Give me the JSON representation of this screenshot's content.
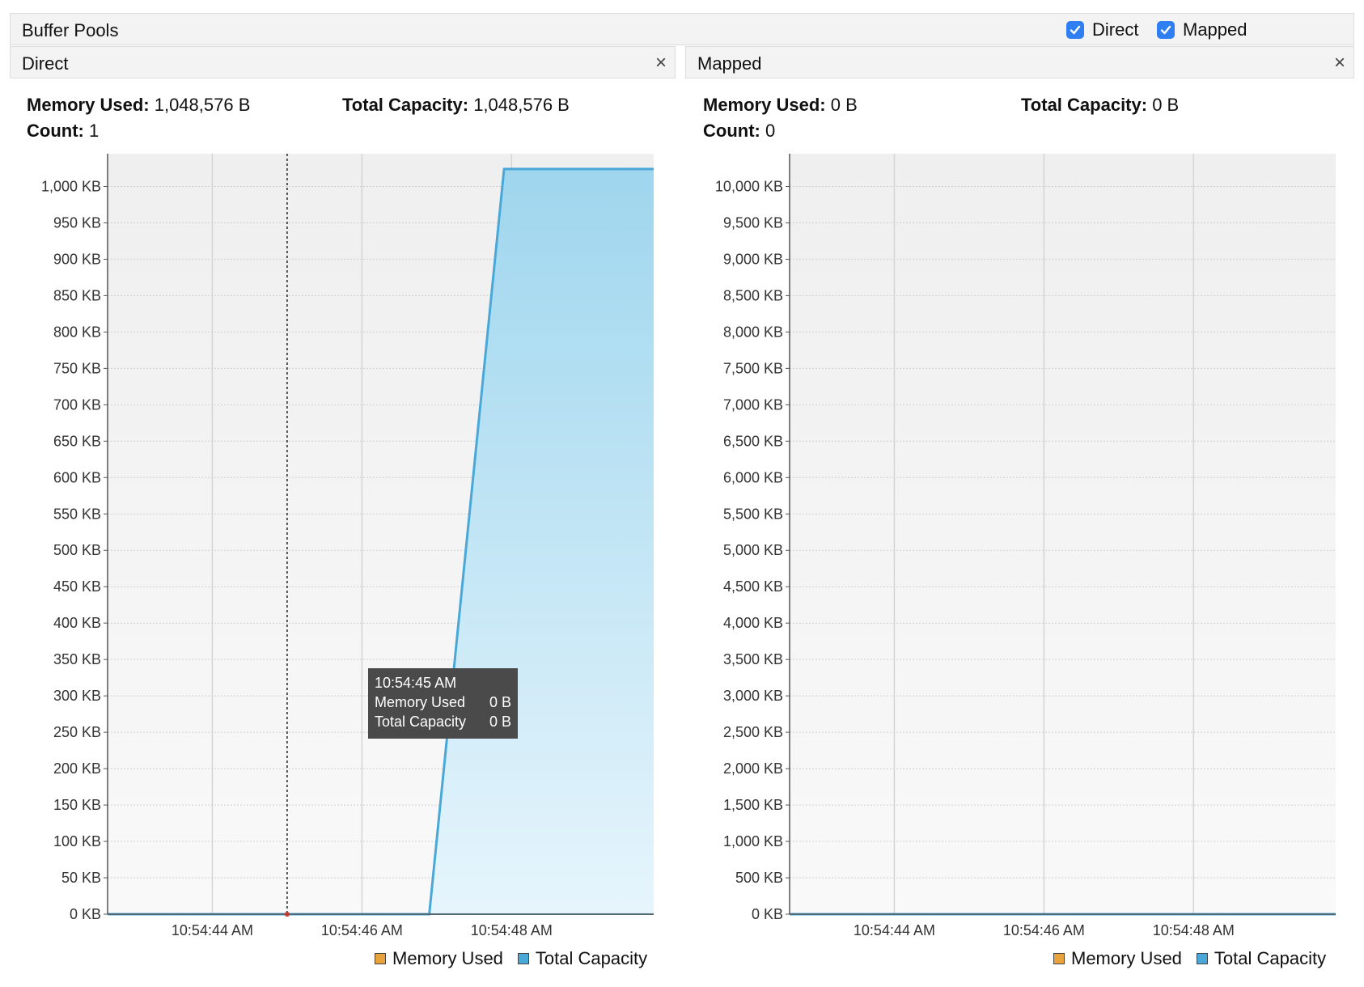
{
  "window": {
    "title": "Buffer Pools",
    "checkboxes": [
      {
        "label": "Direct",
        "checked": true
      },
      {
        "label": "Mapped",
        "checked": true
      }
    ]
  },
  "panels": [
    {
      "name": "Direct",
      "close_icon": "×",
      "stats": {
        "memory_used_label": "Memory Used:",
        "memory_used": "1,048,576 B",
        "total_capacity_label": "Total Capacity:",
        "total_capacity": "1,048,576 B",
        "count_label": "Count:",
        "count": "1"
      },
      "tooltip": {
        "time": "10:54:45 AM",
        "rows": [
          {
            "label": "Memory Used",
            "value": "0 B"
          },
          {
            "label": "Total Capacity",
            "value": "0 B"
          }
        ]
      },
      "legend": [
        "Memory Used",
        "Total Capacity"
      ]
    },
    {
      "name": "Mapped",
      "close_icon": "×",
      "stats": {
        "memory_used_label": "Memory Used:",
        "memory_used": "0 B",
        "total_capacity_label": "Total Capacity:",
        "total_capacity": "0 B",
        "count_label": "Count:",
        "count": "0"
      },
      "legend": [
        "Memory Used",
        "Total Capacity"
      ]
    }
  ],
  "colors": {
    "memory_used": "#e8a33d",
    "total_capacity": "#4aa8d8",
    "checkbox": "#2f7ef2"
  },
  "chart_data": [
    {
      "type": "area",
      "title": "",
      "ylabel": "",
      "xlabel": "",
      "y_unit": "KB",
      "ylim": [
        0,
        1000
      ],
      "y_ticks": [
        "0 KB",
        "50 KB",
        "100 KB",
        "150 KB",
        "200 KB",
        "250 KB",
        "300 KB",
        "350 KB",
        "400 KB",
        "450 KB",
        "500 KB",
        "550 KB",
        "600 KB",
        "650 KB",
        "700 KB",
        "750 KB",
        "800 KB",
        "850 KB",
        "900 KB",
        "950 KB",
        "1,000 KB"
      ],
      "x_ticks": [
        "10:54:44 AM",
        "10:54:46 AM",
        "10:54:48 AM"
      ],
      "x": [
        "10:54:42.6 AM",
        "10:54:45 AM",
        "10:54:46.9 AM",
        "10:54:47.9 AM",
        "10:54:49.9 AM"
      ],
      "series": [
        {
          "name": "Memory Used",
          "values": [
            0,
            0,
            0,
            0,
            0
          ]
        },
        {
          "name": "Total Capacity",
          "values": [
            0,
            0,
            0,
            1024,
            1024
          ]
        }
      ],
      "cursor_time": "10:54:45 AM",
      "grid": true,
      "legend_position": "bottom-right"
    },
    {
      "type": "area",
      "title": "",
      "ylabel": "",
      "xlabel": "",
      "y_unit": "KB",
      "ylim": [
        0,
        10000
      ],
      "y_ticks": [
        "0 KB",
        "500 KB",
        "1,000 KB",
        "1,500 KB",
        "2,000 KB",
        "2,500 KB",
        "3,000 KB",
        "3,500 KB",
        "4,000 KB",
        "4,500 KB",
        "5,000 KB",
        "5,500 KB",
        "6,000 KB",
        "6,500 KB",
        "7,000 KB",
        "7,500 KB",
        "8,000 KB",
        "8,500 KB",
        "9,000 KB",
        "9,500 KB",
        "10,000 KB"
      ],
      "x_ticks": [
        "10:54:44 AM",
        "10:54:46 AM",
        "10:54:48 AM"
      ],
      "x": [
        "10:54:42.6 AM",
        "10:54:49.9 AM"
      ],
      "series": [
        {
          "name": "Memory Used",
          "values": [
            0,
            0
          ]
        },
        {
          "name": "Total Capacity",
          "values": [
            0,
            0
          ]
        }
      ],
      "grid": true,
      "legend_position": "bottom-right"
    }
  ]
}
